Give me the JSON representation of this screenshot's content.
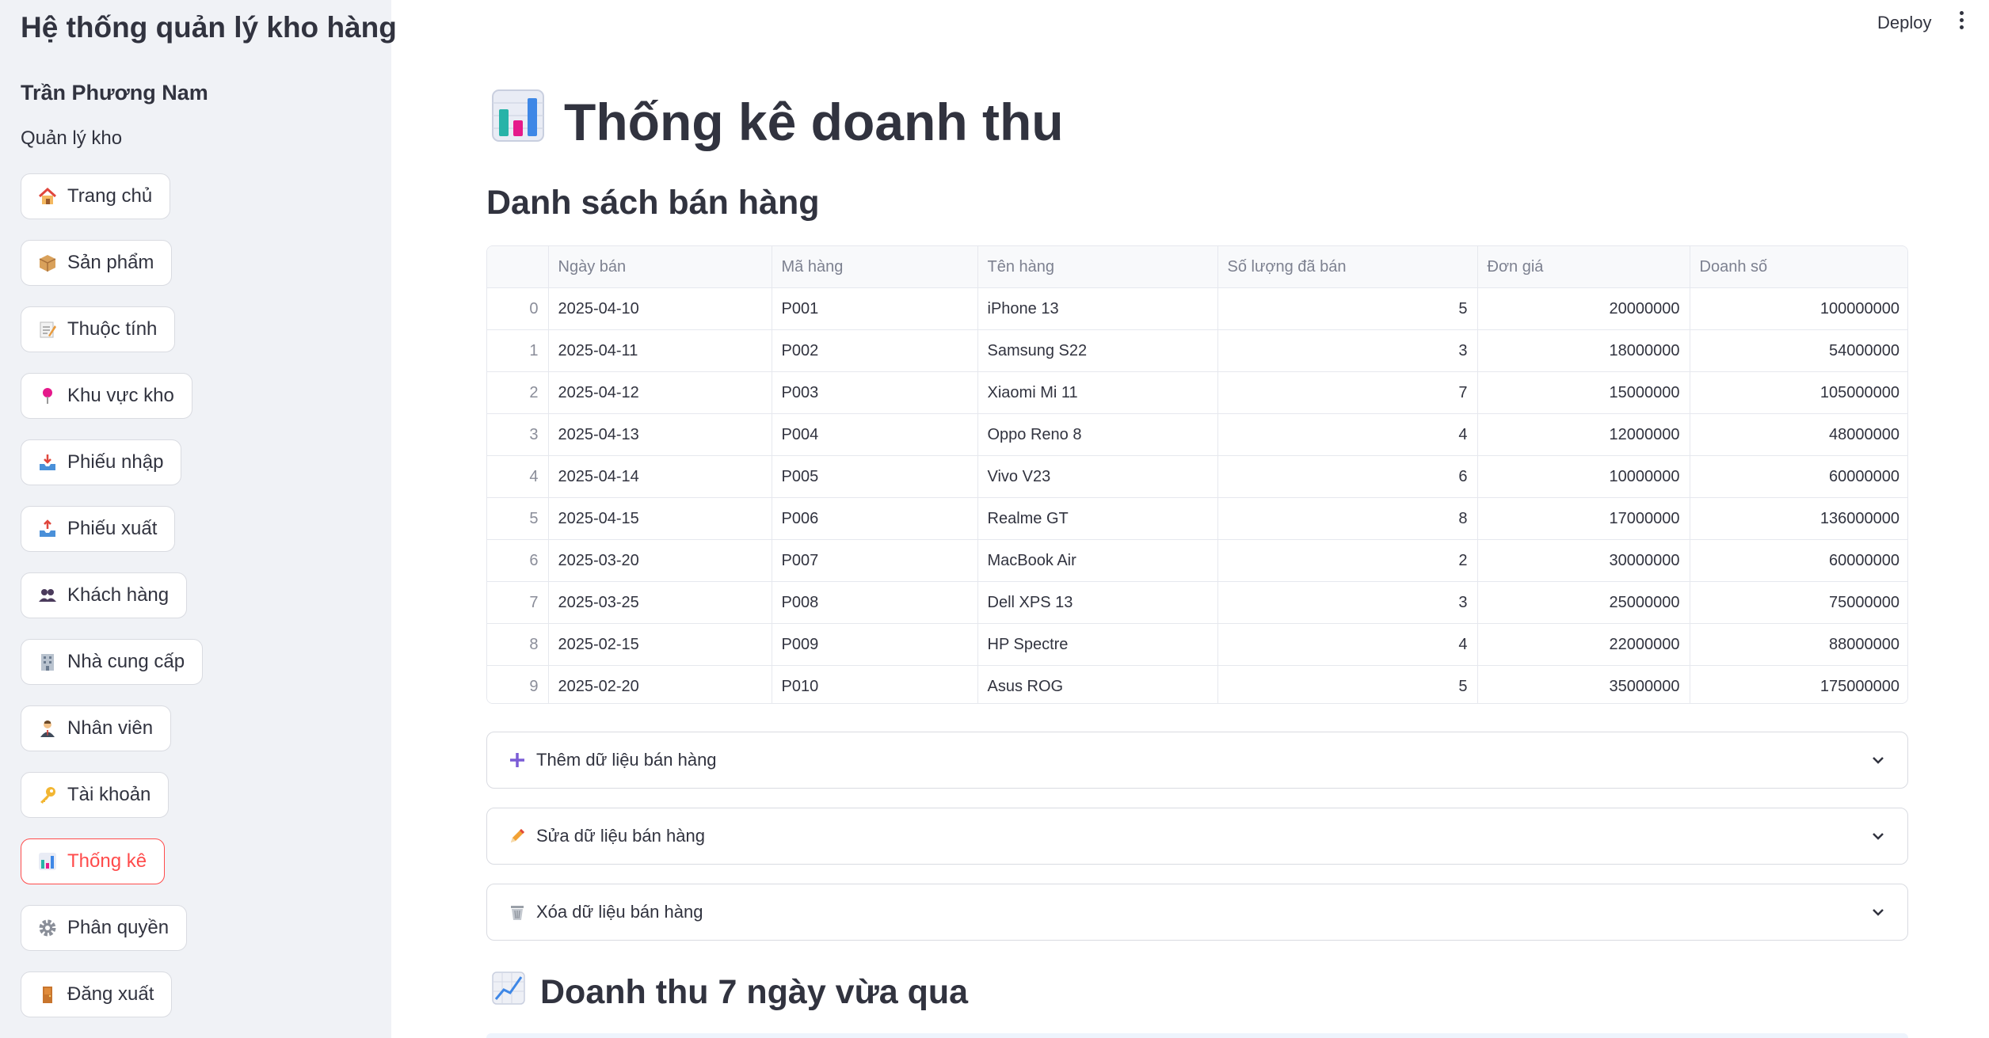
{
  "app": {
    "title": "Hệ thống quản lý kho hàng"
  },
  "user": {
    "name": "Trần Phương Nam",
    "role": "Quản lý kho"
  },
  "sidebar": {
    "items": [
      {
        "label": "Trang chủ",
        "icon": "house-icon"
      },
      {
        "label": "Sản phẩm",
        "icon": "package-icon"
      },
      {
        "label": "Thuộc tính",
        "icon": "memo-icon"
      },
      {
        "label": "Khu vực kho",
        "icon": "pin-icon"
      },
      {
        "label": "Phiếu nhập",
        "icon": "inbox-tray-icon"
      },
      {
        "label": "Phiếu xuất",
        "icon": "outbox-tray-icon"
      },
      {
        "label": "Khách hàng",
        "icon": "people-icon"
      },
      {
        "label": "Nhà cung cấp",
        "icon": "office-building-icon"
      },
      {
        "label": "Nhân viên",
        "icon": "office-worker-icon"
      },
      {
        "label": "Tài khoản",
        "icon": "key-icon"
      },
      {
        "label": "Thống kê",
        "icon": "bar-chart-icon",
        "active": true
      },
      {
        "label": "Phân quyền",
        "icon": "gear-icon"
      },
      {
        "label": "Đăng xuất",
        "icon": "door-icon"
      }
    ]
  },
  "header": {
    "deploy_label": "Deploy"
  },
  "main": {
    "title": "Thống kê doanh thu",
    "section_title": "Danh sách bán hàng",
    "table": {
      "columns": [
        "",
        "Ngày bán",
        "Mã hàng",
        "Tên hàng",
        "Số lượng đã bán",
        "Đơn giá",
        "Doanh số"
      ],
      "rows": [
        [
          "0",
          "2025-04-10",
          "P001",
          "iPhone 13",
          "5",
          "20000000",
          "100000000"
        ],
        [
          "1",
          "2025-04-11",
          "P002",
          "Samsung S22",
          "3",
          "18000000",
          "54000000"
        ],
        [
          "2",
          "2025-04-12",
          "P003",
          "Xiaomi Mi 11",
          "7",
          "15000000",
          "105000000"
        ],
        [
          "3",
          "2025-04-13",
          "P004",
          "Oppo Reno 8",
          "4",
          "12000000",
          "48000000"
        ],
        [
          "4",
          "2025-04-14",
          "P005",
          "Vivo V23",
          "6",
          "10000000",
          "60000000"
        ],
        [
          "5",
          "2025-04-15",
          "P006",
          "Realme GT",
          "8",
          "17000000",
          "136000000"
        ],
        [
          "6",
          "2025-03-20",
          "P007",
          "MacBook Air",
          "2",
          "30000000",
          "60000000"
        ],
        [
          "7",
          "2025-03-25",
          "P008",
          "Dell XPS 13",
          "3",
          "25000000",
          "75000000"
        ],
        [
          "8",
          "2025-02-15",
          "P009",
          "HP Spectre",
          "4",
          "22000000",
          "88000000"
        ],
        [
          "9",
          "2025-02-20",
          "P010",
          "Asus ROG",
          "5",
          "35000000",
          "175000000"
        ]
      ]
    },
    "expanders": [
      {
        "label": "Thêm dữ liệu bán hàng",
        "icon": "plus-icon"
      },
      {
        "label": "Sửa dữ liệu bán hàng",
        "icon": "pencil-icon"
      },
      {
        "label": "Xóa dữ liệu bán hàng",
        "icon": "wastebasket-icon"
      }
    ],
    "chart_section_title": "Doanh thu 7 ngày vừa qua"
  },
  "colors": {
    "accent": "#ff4b4b",
    "sidebar_bg": "#f0f2f6",
    "text": "#31333f"
  }
}
